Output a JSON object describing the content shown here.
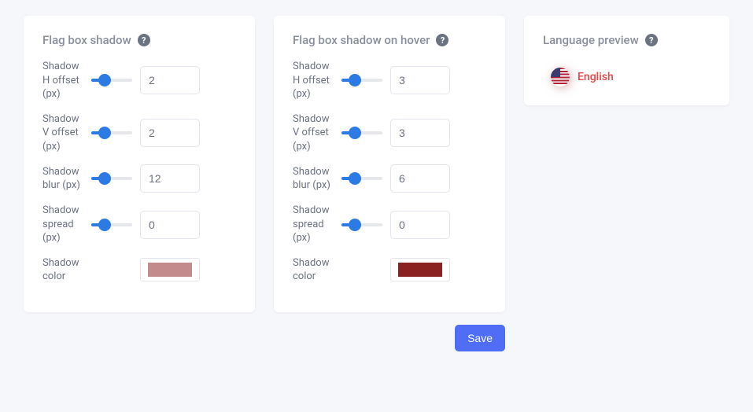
{
  "buttons": {
    "save": "Save"
  },
  "preview": {
    "title": "Language preview",
    "language": "English"
  },
  "panels": [
    {
      "title": "Flag box shadow",
      "controls": [
        {
          "label": "Shadow H offset (px)",
          "value": "2"
        },
        {
          "label": "Shadow V offset (px)",
          "value": "2"
        },
        {
          "label": "Shadow blur (px)",
          "value": "12"
        },
        {
          "label": "Shadow spread (px)",
          "value": "0"
        }
      ],
      "color_label": "Shadow color",
      "color": "#c38b8b"
    },
    {
      "title": "Flag box shadow on hover",
      "controls": [
        {
          "label": "Shadow H offset (px)",
          "value": "3"
        },
        {
          "label": "Shadow V offset (px)",
          "value": "3"
        },
        {
          "label": "Shadow blur (px)",
          "value": "6"
        },
        {
          "label": "Shadow spread (px)",
          "value": "0"
        }
      ],
      "color_label": "Shadow color",
      "color": "#8a2222"
    }
  ]
}
